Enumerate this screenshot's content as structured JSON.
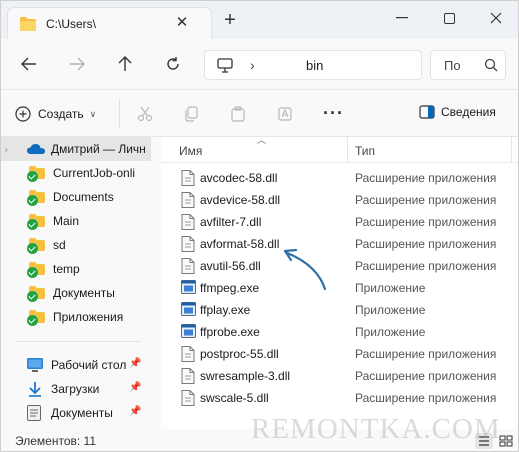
{
  "tab": {
    "title": "C:\\Users\\"
  },
  "navbar": {
    "address_segment": "bin",
    "search_placeholder": "По"
  },
  "toolbar": {
    "create_label": "Создать",
    "details_label": "Сведения"
  },
  "sidebar": {
    "items": [
      {
        "label": "Дмитрий — Личн",
        "icon": "onedrive-cloud-icon"
      },
      {
        "label": "CurrentJob-onli",
        "icon": "folder-synced-icon"
      },
      {
        "label": "Documents",
        "icon": "folder-synced-icon"
      },
      {
        "label": "Main",
        "icon": "folder-synced-icon"
      },
      {
        "label": "sd",
        "icon": "folder-synced-icon"
      },
      {
        "label": "temp",
        "icon": "folder-synced-icon"
      },
      {
        "label": "Документы",
        "icon": "folder-synced-icon"
      },
      {
        "label": "Приложения",
        "icon": "folder-synced-icon"
      }
    ],
    "quick_access": [
      {
        "label": "Рабочий стол",
        "icon": "desktop-icon"
      },
      {
        "label": "Загрузки",
        "icon": "download-icon"
      },
      {
        "label": "Документы",
        "icon": "documents-icon"
      }
    ]
  },
  "columns": {
    "name": "Имя",
    "type": "Тип"
  },
  "files": [
    {
      "name": "avcodec-58.dll",
      "type": "Расширение приложения",
      "icon": "dll-file-icon"
    },
    {
      "name": "avdevice-58.dll",
      "type": "Расширение приложения",
      "icon": "dll-file-icon"
    },
    {
      "name": "avfilter-7.dll",
      "type": "Расширение приложения",
      "icon": "dll-file-icon"
    },
    {
      "name": "avformat-58.dll",
      "type": "Расширение приложения",
      "icon": "dll-file-icon"
    },
    {
      "name": "avutil-56.dll",
      "type": "Расширение приложения",
      "icon": "dll-file-icon"
    },
    {
      "name": "ffmpeg.exe",
      "type": "Приложение",
      "icon": "exe-file-icon"
    },
    {
      "name": "ffplay.exe",
      "type": "Приложение",
      "icon": "exe-file-icon"
    },
    {
      "name": "ffprobe.exe",
      "type": "Приложение",
      "icon": "exe-file-icon"
    },
    {
      "name": "postproc-55.dll",
      "type": "Расширение приложения",
      "icon": "dll-file-icon"
    },
    {
      "name": "swresample-3.dll",
      "type": "Расширение приложения",
      "icon": "dll-file-icon"
    },
    {
      "name": "swscale-5.dll",
      "type": "Расширение приложения",
      "icon": "dll-file-icon"
    }
  ],
  "status": {
    "items_count": "Элементов: 11"
  },
  "watermark": "REMONTKA.COM",
  "colors": {
    "accent": "#0067c0",
    "folder": "#f6c143",
    "sync_ok": "#20a341",
    "annotation_arrow": "#2f6fa8"
  }
}
